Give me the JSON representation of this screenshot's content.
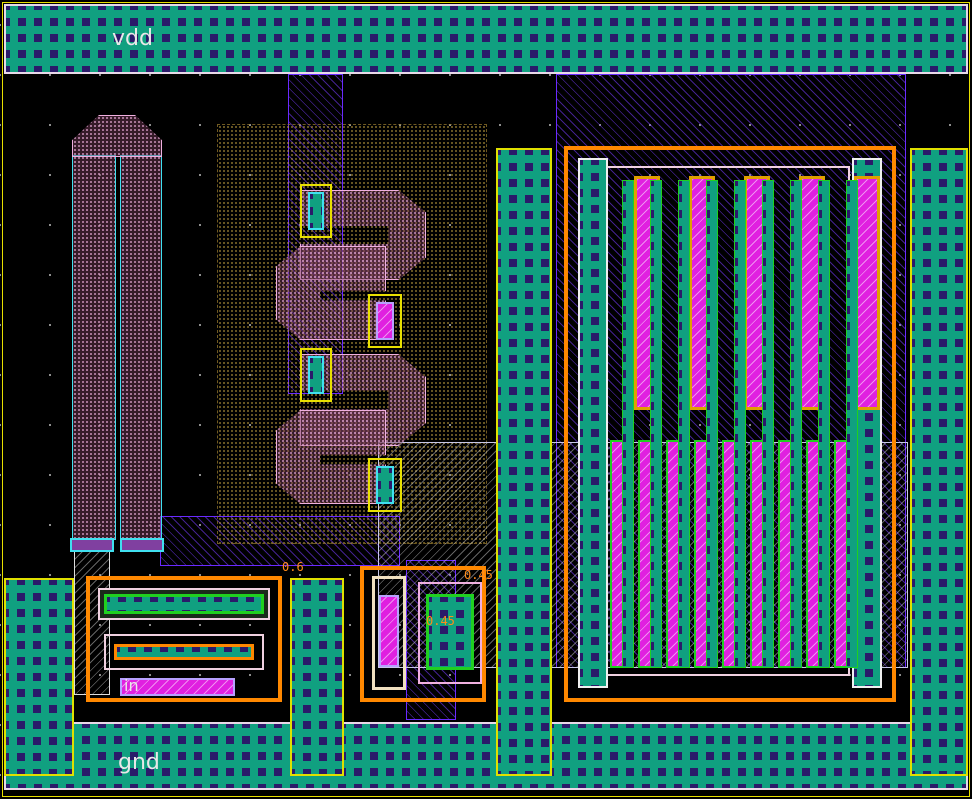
{
  "labels": {
    "power_net": "vdd",
    "ground_net": "gnd",
    "input_net": "in"
  },
  "dimension_labels": [
    "0.6",
    "0.45",
    "0.45"
  ],
  "colors": {
    "background": "#000000",
    "metal1": "#10a080",
    "metal2": "#6a2aff",
    "poly": "#f0b0e0",
    "pdiff": "#e020e0",
    "well_outline": "#ff8800",
    "selection_outline": "#e8e000",
    "cyan_outline": "#40e0f0"
  }
}
